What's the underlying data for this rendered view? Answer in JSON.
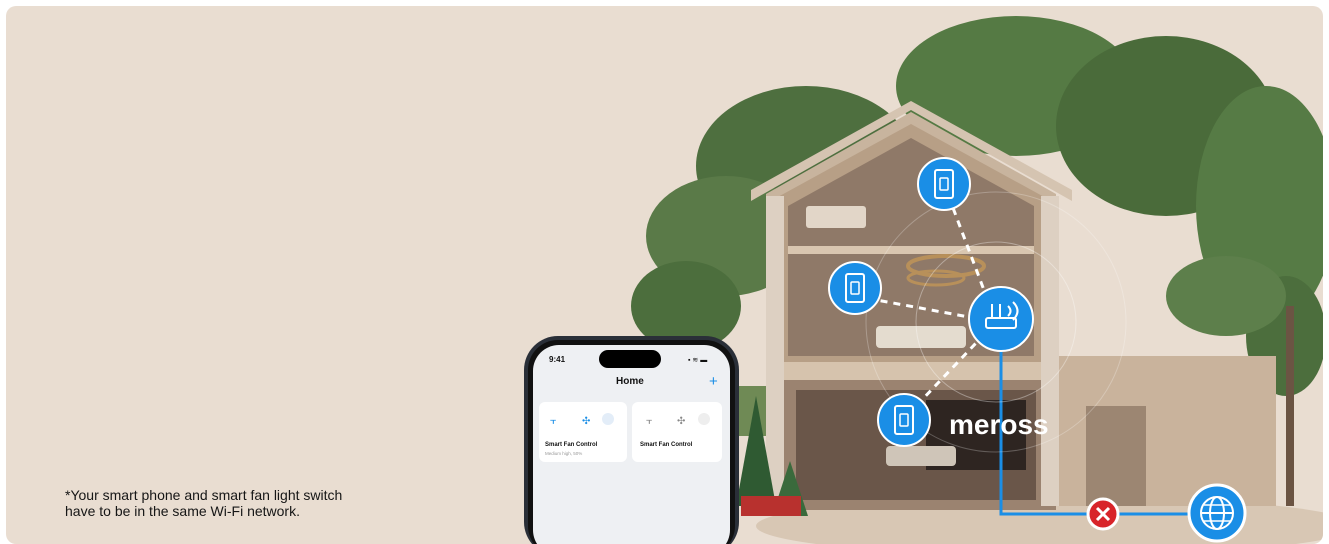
{
  "note": {
    "line1": "*Your smart phone and smart fan light switch",
    "line2": "have to be in the same Wi-Fi network."
  },
  "phone": {
    "time": "9:41",
    "title": "Home",
    "add_icon": "plus-icon",
    "cards": [
      {
        "title": "Smart Fan Control",
        "subtitle": "Medium high, 50%",
        "icons": [
          "fan-light-icon",
          "fan-icon",
          "bulb-icon"
        ]
      },
      {
        "title": "Smart Fan Control",
        "subtitle": "",
        "icons": [
          "fan-light-icon",
          "fan-icon",
          "bulb-icon"
        ]
      }
    ]
  },
  "house": {
    "brand": "meross",
    "devices": [
      "wall-switch-icon",
      "wall-switch-icon",
      "wall-switch-icon"
    ],
    "router_icon": "router-icon",
    "disconnect_icon": "close-icon",
    "internet_icon": "globe-icon"
  },
  "colors": {
    "background": "#e9ddd1",
    "accent_blue": "#1a8ee6",
    "error_red": "#d8242a",
    "tree_green": "#4c6e3d",
    "house_wall": "#c8b49e"
  }
}
